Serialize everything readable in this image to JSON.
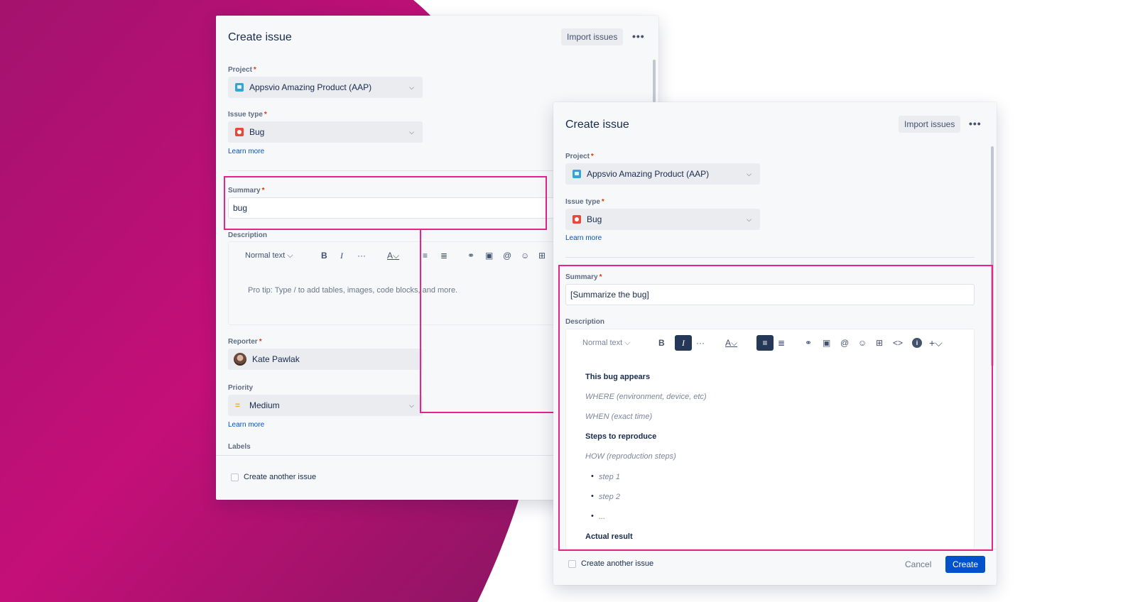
{
  "colors": {
    "background_accent": "#b8106e",
    "highlight": "#e8238a",
    "primary_button": "#0052cc",
    "link": "#0052cc",
    "required": "#de350b"
  },
  "dialog_back": {
    "title": "Create issue",
    "import_label": "Import issues",
    "more_label": "•••",
    "project_label": "Project",
    "project_value": "Appsvio Amazing Product (AAP)",
    "issue_type_label": "Issue type",
    "issue_type_value": "Bug",
    "learn_more": "Learn more",
    "summary_label": "Summary",
    "summary_value": "bug",
    "description_label": "Description",
    "toolbar_text_style": "Normal text",
    "description_placeholder": "Pro tip: Type / to add tables, images, code blocks, and more.",
    "reporter_label": "Reporter",
    "reporter_value": "Kate Pawlak",
    "priority_label": "Priority",
    "priority_value": "Medium",
    "learn_more_2": "Learn more",
    "labels_label": "Labels",
    "create_another": "Create another issue"
  },
  "dialog_front": {
    "title": "Create issue",
    "import_label": "Import issues",
    "more_label": "•••",
    "project_label": "Project",
    "project_value": "Appsvio Amazing Product (AAP)",
    "issue_type_label": "Issue type",
    "issue_type_value": "Bug",
    "learn_more": "Learn more",
    "summary_label": "Summary",
    "summary_value": "[Summarize the bug]",
    "description_label": "Description",
    "toolbar_text_style": "Normal text",
    "template": {
      "heading_1": "This bug appears",
      "where": "WHERE (environment, device, etc)",
      "when": "WHEN (exact time)",
      "heading_2": "Steps to reproduce",
      "how": "HOW (reproduction steps)",
      "steps": [
        "step 1",
        "step 2",
        "..."
      ],
      "heading_3": "Actual result"
    },
    "create_another": "Create another issue",
    "cancel_label": "Cancel",
    "create_label": "Create"
  },
  "icons": {
    "project": "project-icon",
    "bug": "bug-icon",
    "priority": "priority-medium-icon",
    "toolbar": [
      "bold-icon",
      "italic-icon",
      "more-formatting-icon",
      "text-color-icon",
      "bullet-list-icon",
      "numbered-list-icon",
      "link-icon",
      "image-icon",
      "mention-icon",
      "emoji-icon",
      "table-icon",
      "code-icon",
      "info-icon",
      "insert-icon"
    ]
  }
}
